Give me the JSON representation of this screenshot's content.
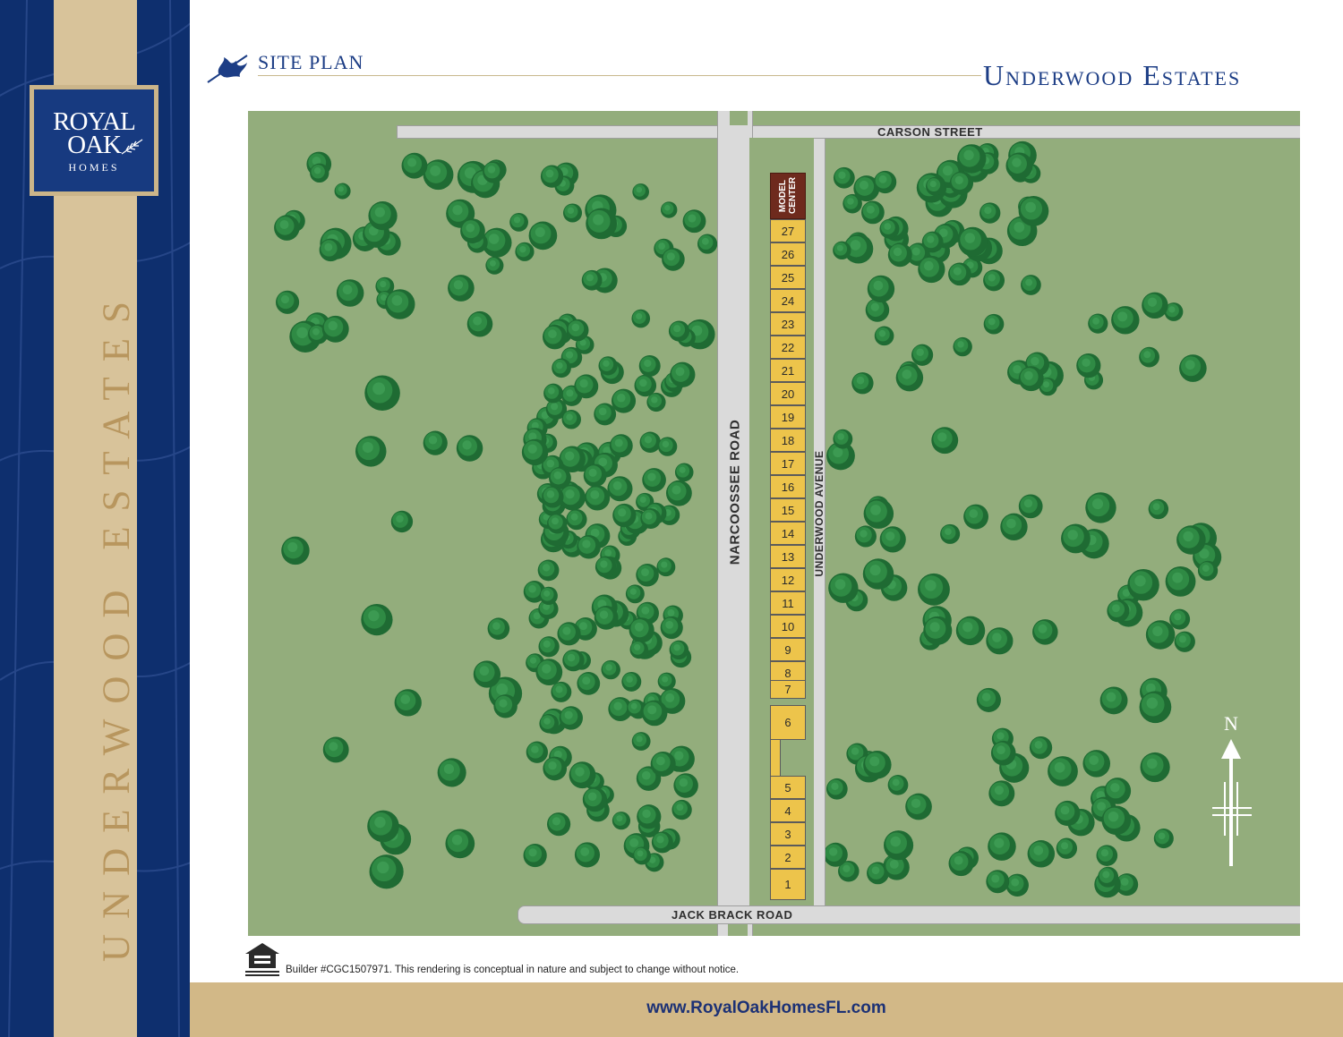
{
  "brand": {
    "logo_line1": "ROYAL",
    "logo_line2": "OAK",
    "logo_line3": "HOMES",
    "sidebar_title": "UNDERWOOD ESTATES",
    "colors": {
      "navy": "#0e2f6e",
      "tan": "#d8c39a",
      "gold_text": "#b8965e"
    }
  },
  "header": {
    "section_label": "SITE PLAN",
    "title": "Underwood Estates",
    "icon": "oak-leaf-icon"
  },
  "map": {
    "roads": {
      "carson": "CARSON STREET",
      "narcoossee": "NARCOOSSEE ROAD",
      "underwood": "UNDERWOOD AVENUE",
      "jack_brack": "JACK BRACK ROAD"
    },
    "model_center_label": "MODEL CENTER",
    "lots": [
      "27",
      "26",
      "25",
      "24",
      "23",
      "22",
      "21",
      "20",
      "19",
      "18",
      "17",
      "16",
      "15",
      "14",
      "13",
      "12",
      "11",
      "10",
      "9",
      "8",
      "7",
      "6",
      "5",
      "4",
      "3",
      "2",
      "1"
    ],
    "north_label": "N",
    "colors": {
      "grass": "#93ad7c",
      "road": "#dadada",
      "lot": "#edc44b",
      "model_center": "#6e2a1d",
      "tree": "#2e7a3c"
    }
  },
  "footer": {
    "equal_housing_icon": "equal-housing-opportunity-icon",
    "disclaimer": "Builder #CGC1507971. This rendering is conceptual in nature and subject to change without notice.",
    "website": "www.RoyalOakHomesFL.com"
  }
}
